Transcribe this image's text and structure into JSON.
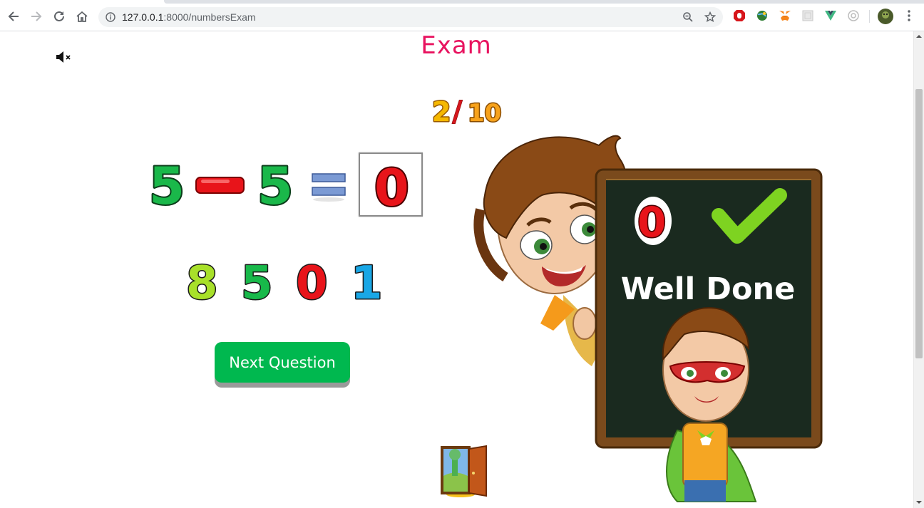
{
  "browser": {
    "url_host": "127.0.0.1",
    "url_rest": ":8000/numbersExam"
  },
  "page": {
    "title": "Exam",
    "progress": {
      "current": "2",
      "separator": "/",
      "total": "10"
    }
  },
  "question": {
    "operand1": "5",
    "operator": "−",
    "operand2": "5",
    "equals": "=",
    "answer": "0"
  },
  "choices": [
    {
      "value": "8",
      "color": "#a8e02a"
    },
    {
      "value": "5",
      "color": "#18b94a"
    },
    {
      "value": "0",
      "color": "#e8141a"
    },
    {
      "value": "1",
      "color": "#19a7e6"
    }
  ],
  "next_button": {
    "label": "Next Question"
  },
  "feedback": {
    "selected": "0",
    "message": "Well Done",
    "board_color": "#1a2a1f",
    "frame_color": "#7a4a1c",
    "check_color": "#7ed321"
  },
  "colors": {
    "green_digit": "#1ab84a",
    "red_digit": "#e8141a",
    "title": "#e8135f",
    "button": "#00b84f"
  }
}
